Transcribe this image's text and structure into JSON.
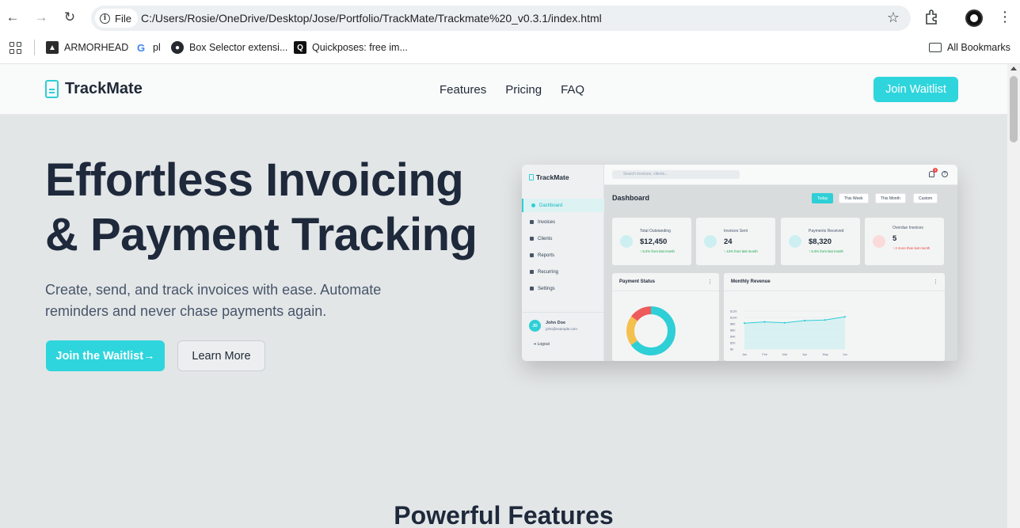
{
  "browser": {
    "chip_label": "File",
    "url": "C:/Users/Rosie/OneDrive/Desktop/Jose/Portfolio/TrackMate/Trackmate%20_v0.3.1/index.html",
    "bookmarks": [
      {
        "label": "ARMORHEAD",
        "icon": "armorhead-favicon"
      },
      {
        "label": "pl",
        "icon": "google-favicon"
      },
      {
        "label": "Box Selector extensi...",
        "icon": "github-favicon"
      },
      {
        "label": "Quickposes: free im...",
        "icon": "quickposes-favicon"
      }
    ],
    "all_bookmarks": "All Bookmarks"
  },
  "site": {
    "brand": "TrackMate",
    "nav": [
      "Features",
      "Pricing",
      "FAQ"
    ],
    "cta": "Join Waitlist",
    "accent": "#2fd5dd"
  },
  "hero": {
    "title_line1": "Effortless Invoicing",
    "title_line2": "& Payment Tracking",
    "subtitle": "Create, send, and track invoices with ease. Automate reminders and never chase payments again.",
    "primary_button": "Join the Waitlist→",
    "secondary_button": "Learn More"
  },
  "features_title": "Powerful Features",
  "mockup": {
    "brand": "TrackMate",
    "search_placeholder": "Search invoices, clients...",
    "notifications": "3",
    "help": "?",
    "menu": [
      "Dashboard",
      "Invoices",
      "Clients",
      "Reports",
      "Recurring",
      "Settings"
    ],
    "user_initials": "JD",
    "user_name": "John Doe",
    "user_email": "john@example.com",
    "logout": "Logout",
    "title": "Dashboard",
    "filters": [
      "Today",
      "This Week",
      "This Month",
      "Custom"
    ],
    "cards": [
      {
        "label": "Total Outstanding",
        "value": "$12,450",
        "change": "↑ 8.2% from last month",
        "color": "#2ecfd6"
      },
      {
        "label": "Invoices Sent",
        "value": "24",
        "change": "↑ 12% from last month",
        "color": "#2ecfd6"
      },
      {
        "label": "Payments Received",
        "value": "$8,320",
        "change": "↑ 5.3% from last month",
        "color": "#2ecfd6"
      },
      {
        "label": "Overdue Invoices",
        "value": "5",
        "change": "↑ 2 more than last month",
        "color": "#ef4444"
      }
    ],
    "payment_status_title": "Payment Status",
    "monthly_revenue_title": "Monthly Revenue",
    "menu_glyph": "⋮",
    "donut_colors": [
      "#2ecfd6",
      "#f4c04e",
      "#ef5b5b"
    ],
    "donut": [
      {
        "value": 65
      },
      {
        "value": 20
      },
      {
        "value": 15
      }
    ],
    "revenue_y_ticks": [
      "$12K",
      "$10K",
      "$8K",
      "$6K",
      "$4K",
      "$2K",
      "$0"
    ],
    "revenue_months": [
      "Jan",
      "Feb",
      "Mar",
      "Apr",
      "May",
      "Jun"
    ],
    "revenue_points": [
      8.2,
      8.6,
      8.3,
      9.0,
      9.2,
      10.2
    ]
  }
}
